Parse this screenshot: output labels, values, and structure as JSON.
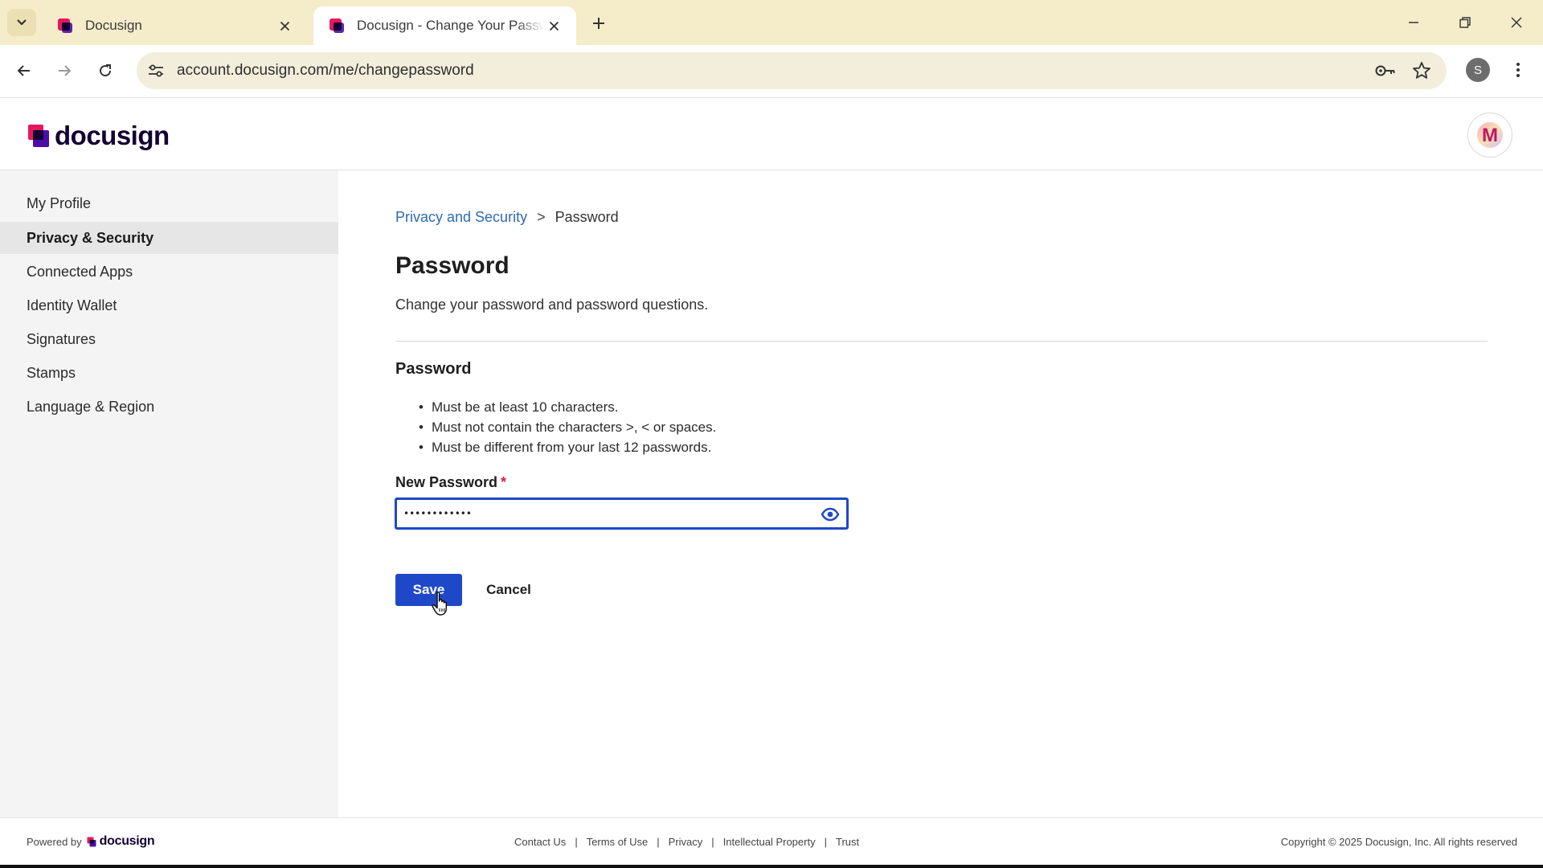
{
  "browser": {
    "tabs": [
      {
        "title": "Docusign",
        "active": false
      },
      {
        "title": "Docusign - Change Your Password",
        "active": true
      }
    ],
    "url": "account.docusign.com/me/changepassword",
    "profile_initial": "S"
  },
  "header": {
    "logo_text": "docusign",
    "avatar_initial": "M"
  },
  "sidebar": {
    "items": [
      {
        "label": "My Profile",
        "selected": false
      },
      {
        "label": "Privacy & Security",
        "selected": true
      },
      {
        "label": "Connected Apps",
        "selected": false
      },
      {
        "label": "Identity Wallet",
        "selected": false
      },
      {
        "label": "Signatures",
        "selected": false
      },
      {
        "label": "Stamps",
        "selected": false
      },
      {
        "label": "Language & Region",
        "selected": false
      }
    ]
  },
  "main": {
    "breadcrumb": {
      "parent": "Privacy and Security",
      "separator": ">",
      "current": "Password"
    },
    "title": "Password",
    "subtitle": "Change your password and password questions.",
    "section_title": "Password",
    "rules": [
      "Must be at least 10 characters.",
      "Must not contain the characters >, < or spaces.",
      "Must be different from your last 12 passwords."
    ],
    "new_password": {
      "label": "New Password",
      "required_mark": "*",
      "value": "••••••••••••"
    },
    "save_label": "Save",
    "cancel_label": "Cancel"
  },
  "footer": {
    "powered_by": "Powered by",
    "brand": "docusign",
    "links": [
      "Contact Us",
      "Terms of Use",
      "Privacy",
      "Intellectual Property",
      "Trust"
    ],
    "copyright": "Copyright © 2025 Docusign, Inc. All rights reserved"
  },
  "colors": {
    "accent": "#1f48c9",
    "link": "#2d6ab4",
    "brand_dark": "#130032",
    "tabstrip": "#f5ecc9"
  },
  "icons": [
    "tab-search-icon",
    "favicon-docusign-icon",
    "close-icon",
    "plus-icon",
    "minimize-icon",
    "restore-icon",
    "window-close-icon",
    "back-icon",
    "forward-icon",
    "reload-icon",
    "site-settings-icon",
    "password-key-icon",
    "bookmark-star-icon",
    "kebab-menu-icon",
    "eye-icon",
    "pointer-cursor-icon"
  ]
}
